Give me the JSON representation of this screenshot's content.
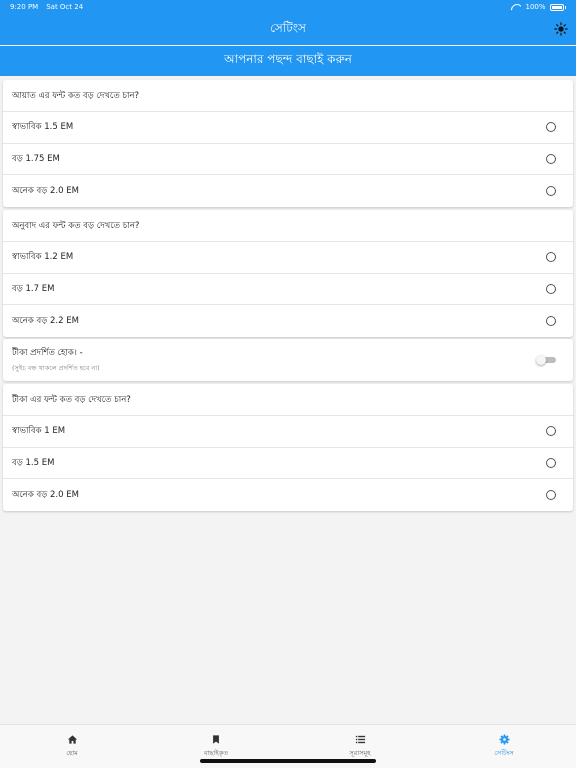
{
  "status": {
    "time": "9:20 PM",
    "date": "Sat Oct 24",
    "battery": "100%"
  },
  "appbar": {
    "title": "সেটিংস"
  },
  "subheader": {
    "title": "আপনার পছন্দ বাছাই করুন"
  },
  "ayat_font": {
    "question": "আয়াত এর ফন্ট কত বড় দেখতে চান?",
    "options": [
      "স্বাভাবিক 1.5 EM",
      "বড় 1.75 EM",
      "অনেক বড় 2.0 EM"
    ]
  },
  "translation_font": {
    "question": "অনুবাদ এর ফন্ট কত বড় দেখতে চান?",
    "options": [
      "স্বাভাবিক 1.2 EM",
      "বড় 1.7 EM",
      "অনেক বড় 2.2 EM"
    ]
  },
  "tika_toggle": {
    "label": "টীকা প্রদর্শিত হোক।  -",
    "hint": "(সুইচ বন্ধ থাকলে প্রদর্শিত হবে না)",
    "on": false
  },
  "tika_font": {
    "question": "টীকা এর ফন্ট কত বড় দেখতে চান?",
    "options": [
      "স্বাভাবিক 1 EM",
      "বড় 1.5 EM",
      "অনেক বড় 2.0 EM"
    ]
  },
  "nav": {
    "items": [
      {
        "label": "হোম",
        "icon": "home-icon"
      },
      {
        "label": "বাছাইকৃত",
        "icon": "bookmark-icon"
      },
      {
        "label": "সূরাসমূহ",
        "icon": "list-icon"
      },
      {
        "label": "সেটিংস",
        "icon": "gear-icon"
      }
    ],
    "active_index": 3
  },
  "colors": {
    "primary": "#2196f3",
    "background": "#f3f3f3"
  }
}
